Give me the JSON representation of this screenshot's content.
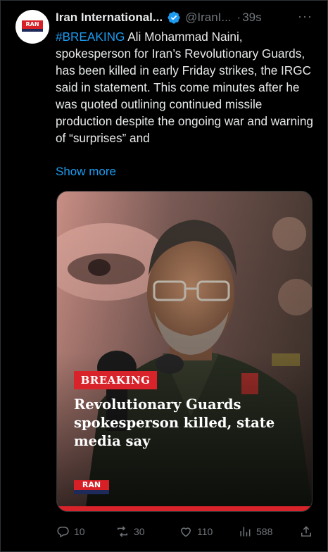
{
  "account": {
    "display_name": "Iran International...",
    "handle": "@IranI...",
    "separator": "·",
    "time": "39s",
    "more_label": "···",
    "avatar_logo_text": "RAN",
    "verified_icon": "verified-badge-icon"
  },
  "tweet": {
    "hashtag": "#BREAKING",
    "body": " Ali Mohammad Naini, spokesperson for Iran’s Revolutionary Guards, has been killed in early Friday strikes, the IRGC said in statement. This come minutes after he was quoted outlining continued missile production despite the ongoing war and warning of “surprises” and",
    "show_more": "Show more"
  },
  "media": {
    "badge": "BREAKING",
    "headline": "Revolutionary Guards spokesperson killed, state media say",
    "logo_text": "RAN"
  },
  "actions": {
    "reply_count": "10",
    "repost_count": "30",
    "like_count": "110",
    "views_count": "588"
  },
  "colors": {
    "accent": "#1d9bf0",
    "brand_red": "#d8232a",
    "muted": "#71767b",
    "text": "#e7e9ea"
  }
}
